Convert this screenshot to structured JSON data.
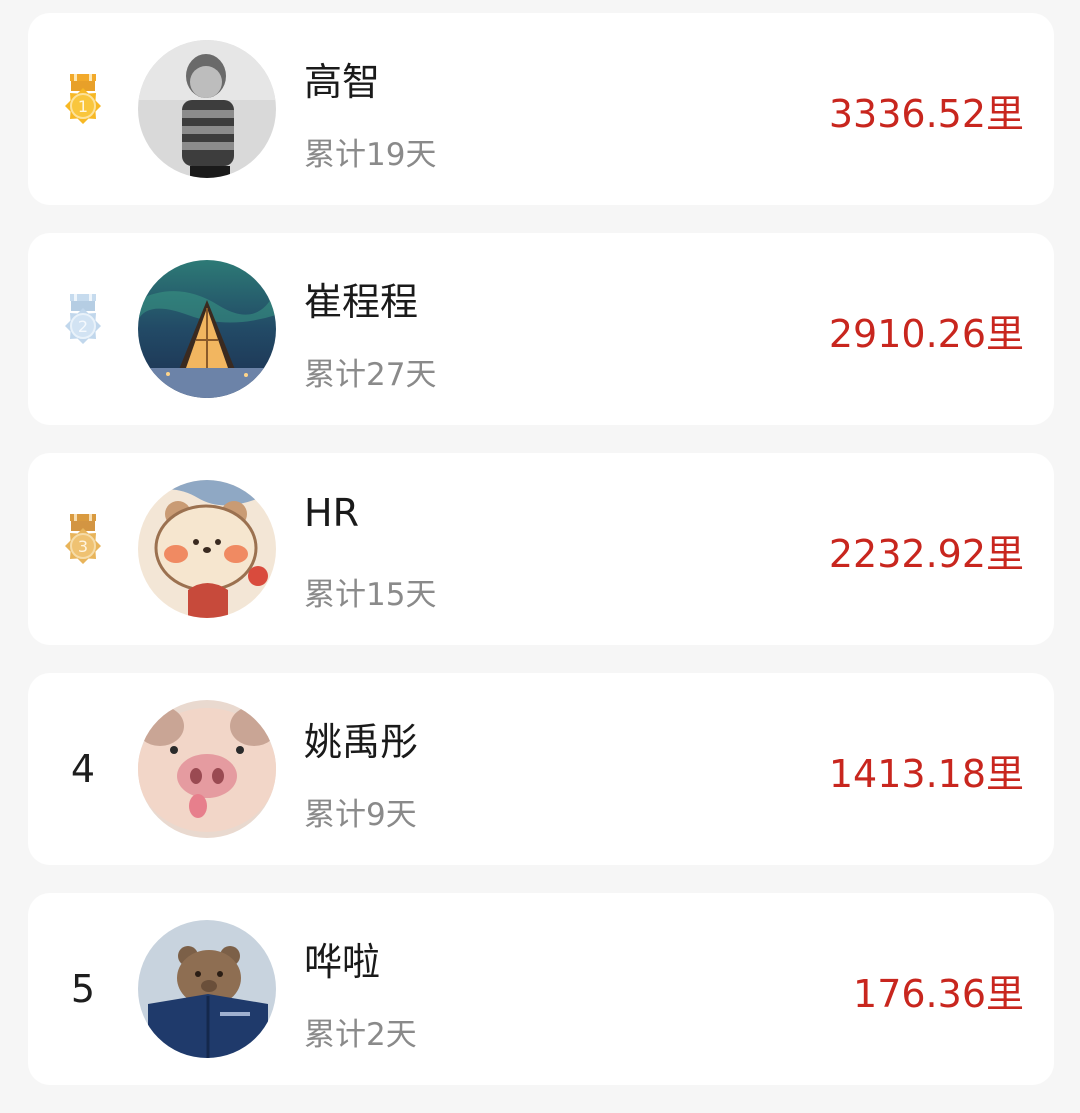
{
  "ranking": {
    "items": [
      {
        "rank": "1",
        "rank_type": "medal",
        "medal_color": "#f5b41c",
        "medal_icon": "gold-medal-icon",
        "avatar_icon": "avatar-boy-photo",
        "name": "高智",
        "days": "累计19天",
        "distance": "3336.52里"
      },
      {
        "rank": "2",
        "rank_type": "medal",
        "medal_color": "#b9d3ea",
        "medal_icon": "silver-medal-icon",
        "avatar_icon": "avatar-aurora-cabin-photo",
        "name": "崔程程",
        "days": "累计27天",
        "distance": "2910.26里"
      },
      {
        "rank": "3",
        "rank_type": "medal",
        "medal_color": "#eab85a",
        "medal_icon": "bronze-medal-icon",
        "avatar_icon": "avatar-bear-cartoon",
        "name": "HR",
        "days": "累计15天",
        "distance": "2232.92里"
      },
      {
        "rank": "4",
        "rank_type": "number",
        "avatar_icon": "avatar-piglet-photo",
        "name": "姚禹彤",
        "days": "累计9天",
        "distance": "1413.18里"
      },
      {
        "rank": "5",
        "rank_type": "number",
        "avatar_icon": "avatar-teddy-book-photo",
        "name": "哗啦",
        "days": "累计2天",
        "distance": "176.36里"
      }
    ]
  }
}
